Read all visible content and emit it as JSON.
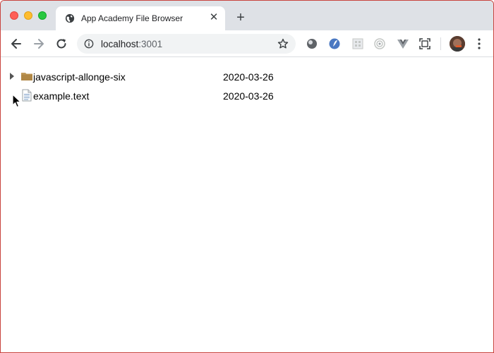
{
  "window": {
    "tab": {
      "title": "App Academy File Browser",
      "close_glyph": "✕"
    },
    "new_tab_glyph": "+",
    "address": {
      "host": "localhost",
      "port": ":3001"
    }
  },
  "icons": {
    "tab_favicon": "globe-icon",
    "back": "arrow-left-icon",
    "forward": "arrow-right-icon",
    "reload": "reload-icon",
    "info": "info-icon",
    "bookmark": "star-icon",
    "menu": "more-vertical-icon"
  },
  "colors": {
    "folder": "#c09a5b",
    "tab_strip": "#dee1e6",
    "omnibox": "#f1f3f4"
  },
  "files": [
    {
      "name": "javascript-allonge-six",
      "date": "2020-03-26",
      "type": "folder"
    },
    {
      "name": "example.text",
      "date": "2020-03-26",
      "type": "file"
    }
  ]
}
